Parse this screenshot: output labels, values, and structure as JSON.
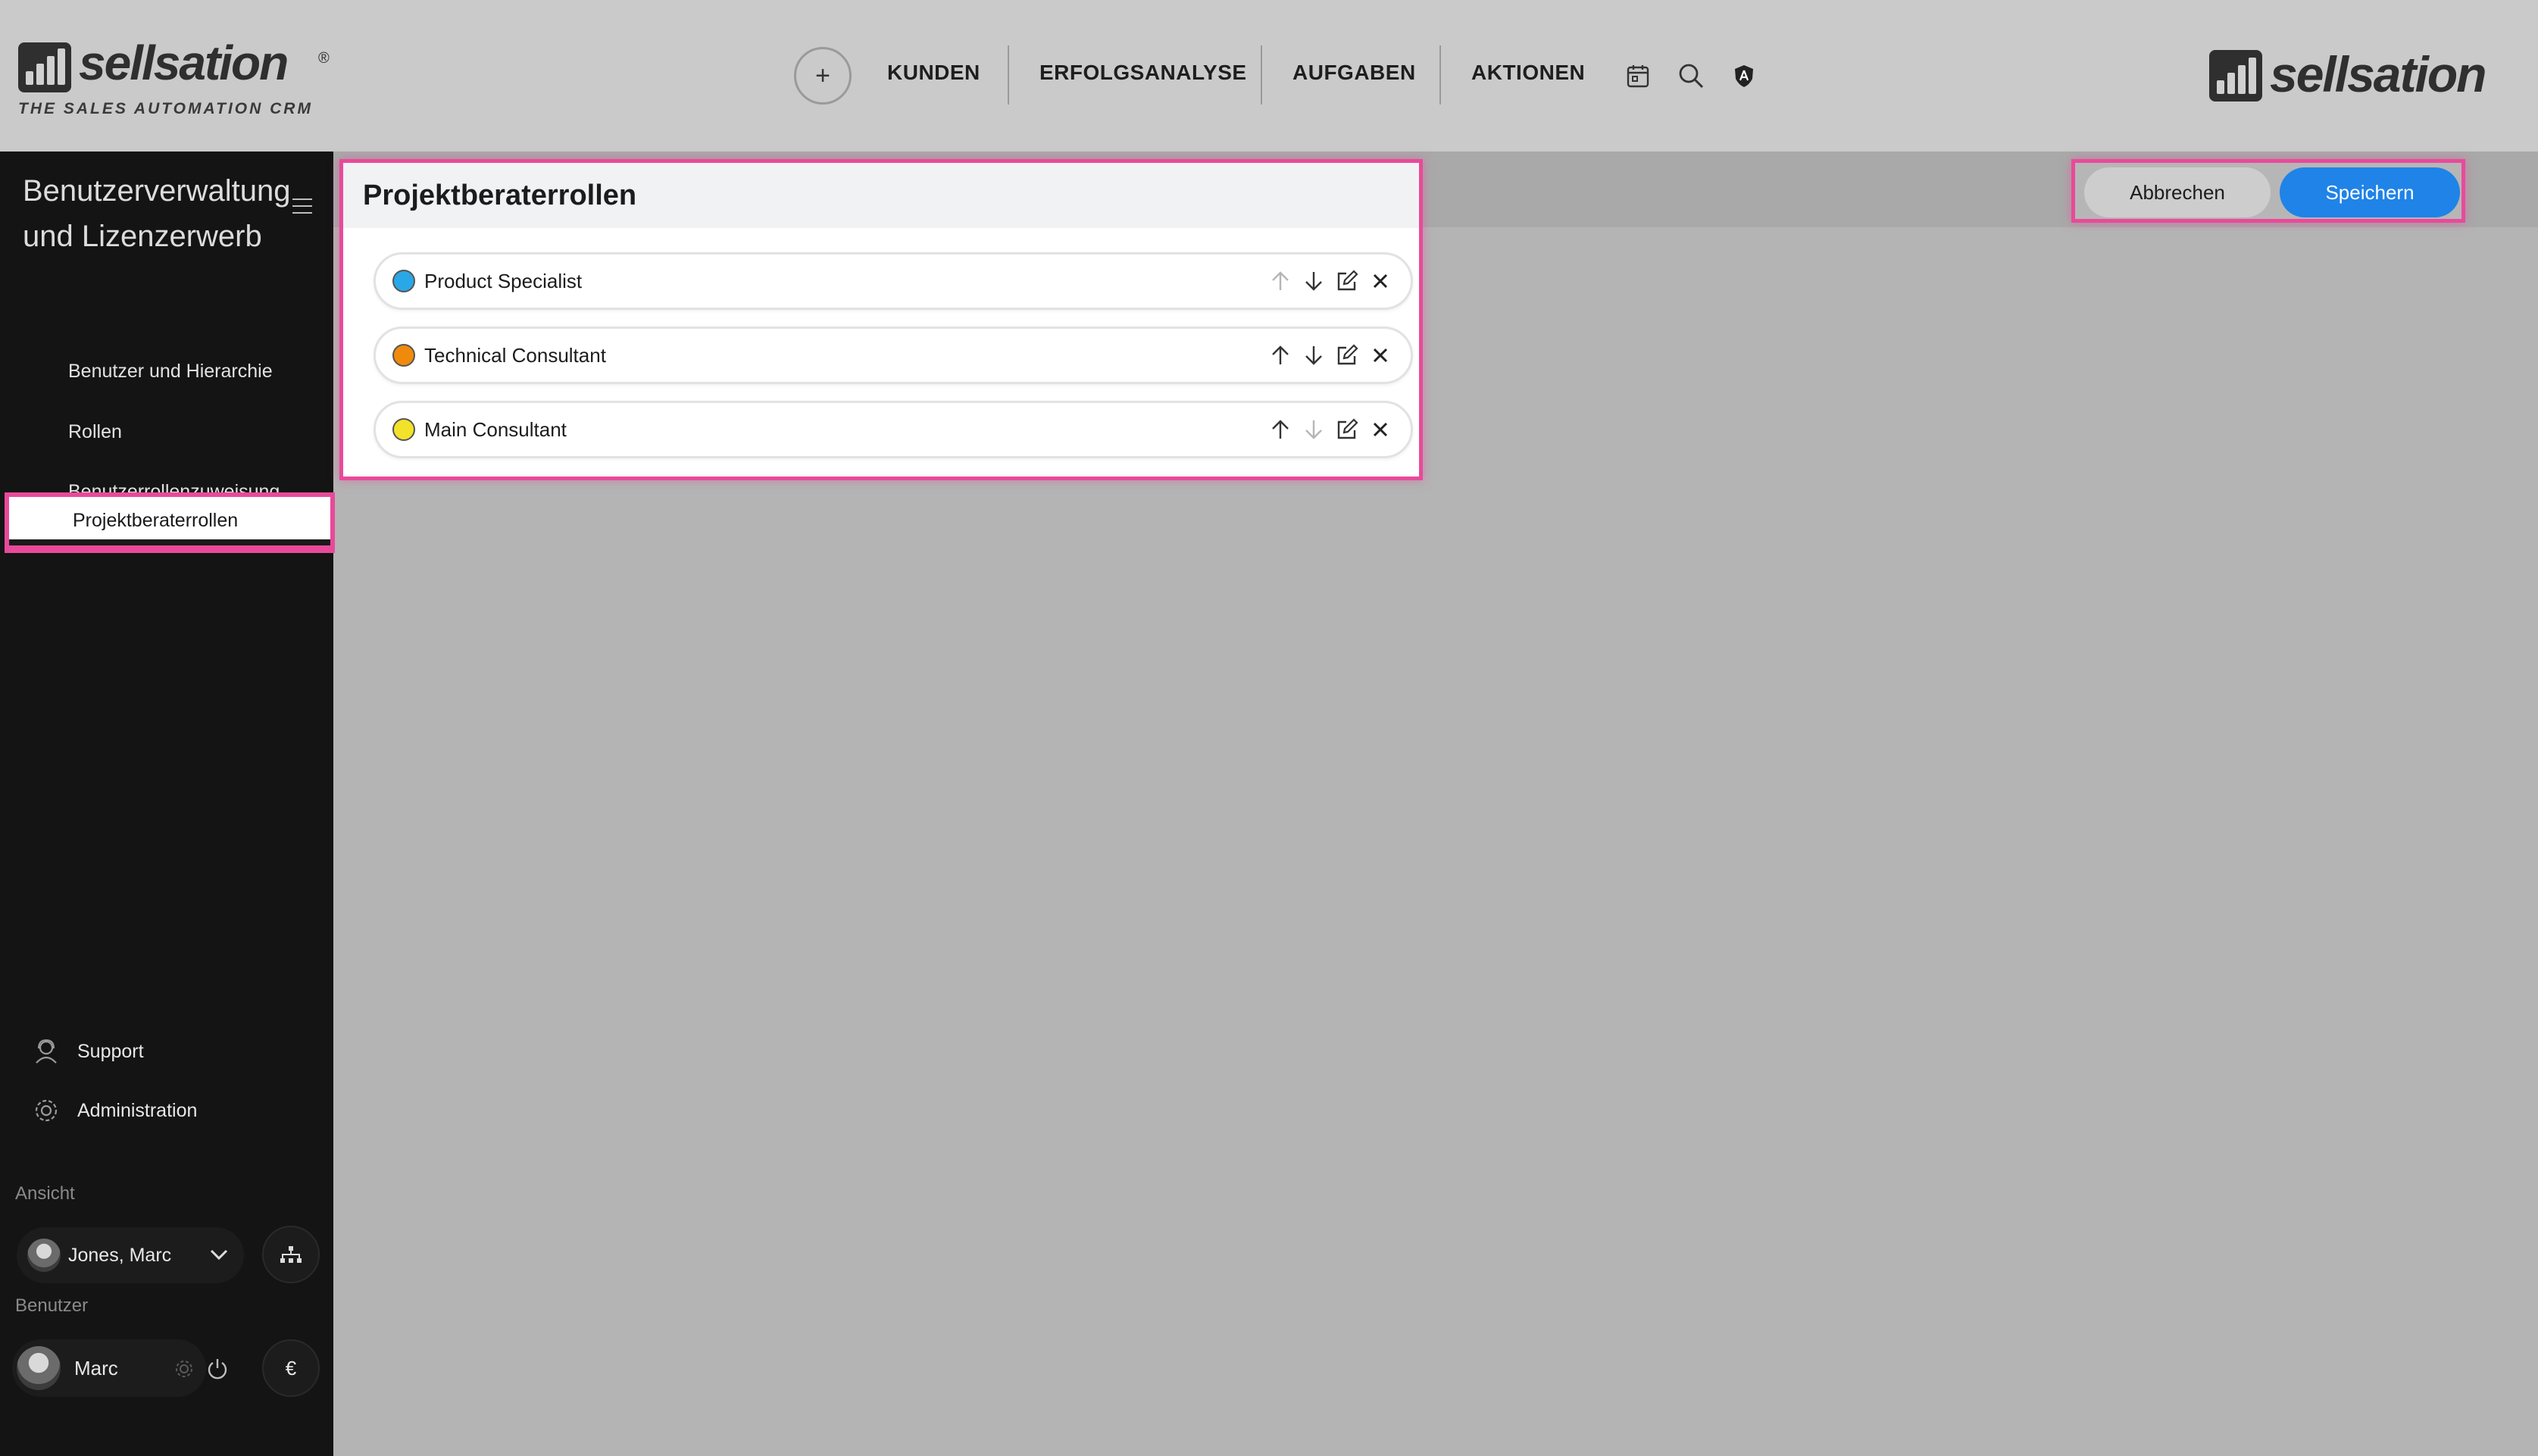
{
  "brand": {
    "logo_word": "sellsation",
    "registered": "®",
    "tagline": "THE SALES AUTOMATION CRM"
  },
  "topnav": {
    "add_label": "+",
    "items": [
      {
        "label": "KUNDEN"
      },
      {
        "label": "ERFOLGSANALYSE"
      },
      {
        "label": "AUFGABEN"
      },
      {
        "label": "AKTIONEN"
      }
    ],
    "icons": [
      "calendar-icon",
      "search-icon",
      "shield-icon"
    ]
  },
  "sidebar": {
    "title": "Benutzerverwaltung und Lizenzerwerb",
    "items": [
      {
        "label": "Benutzer und Hierarchie",
        "active": false
      },
      {
        "label": "Rollen",
        "active": false
      },
      {
        "label": "Benutzerrollenzuweisung",
        "active": false
      },
      {
        "label": "Projektberaterrollen",
        "active": true
      }
    ],
    "support_label": "Support",
    "administration_label": "Administration",
    "view_caption": "Ansicht",
    "view_user": "Jones, Marc",
    "user_caption": "Benutzer",
    "user_name": "Marc",
    "currency_label": "€"
  },
  "panel": {
    "title": "Projektberaterrollen",
    "roles": [
      {
        "name": "Product Specialist",
        "color": "#2aa7e6"
      },
      {
        "name": "Technical Consultant",
        "color": "#f08a0c"
      },
      {
        "name": "Main Consultant",
        "color": "#f3e22a"
      }
    ]
  },
  "actions": {
    "cancel_label": "Abbrechen",
    "save_label": "Speichern"
  },
  "colors": {
    "accent": "#1f83e8",
    "highlight": "#e84a9a",
    "sidebar_bg": "#141414"
  }
}
